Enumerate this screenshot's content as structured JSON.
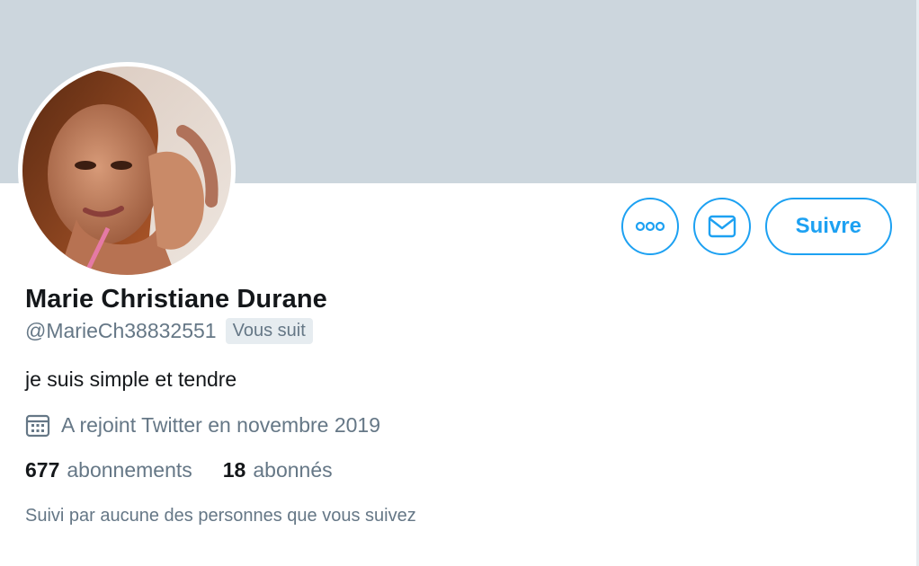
{
  "profile": {
    "name": "Marie Christiane Durane",
    "handle": "@MarieCh38832551",
    "follows_you_badge": "Vous suit",
    "bio": "je suis simple et tendre",
    "joined": "A rejoint Twitter en novembre 2019",
    "followed_by_text": "Suivi par aucune des personnes que vous suivez"
  },
  "stats": {
    "following_count": "677",
    "following_label": "abonnements",
    "followers_count": "18",
    "followers_label": "abonnés"
  },
  "actions": {
    "follow_label": "Suivre",
    "more_icon": "more-icon",
    "message_icon": "envelope-icon"
  },
  "colors": {
    "accent": "#1da1f2",
    "banner": "#ccd6dd",
    "secondary_text": "#657786",
    "primary_text": "#14171a"
  }
}
